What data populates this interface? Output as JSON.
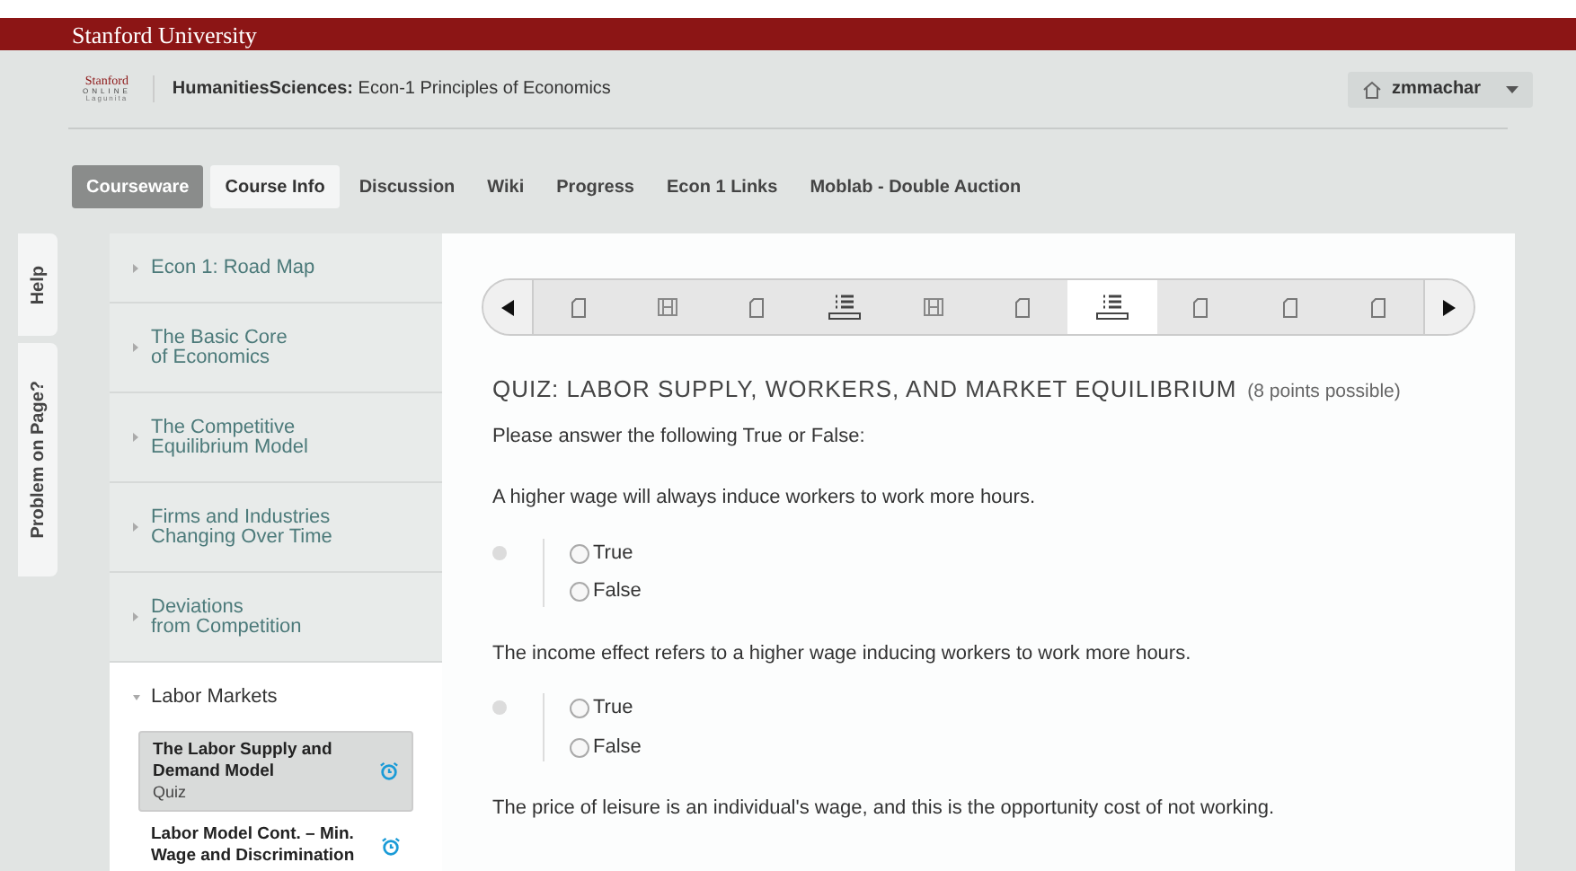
{
  "university_bar": {
    "title": "Stanford University"
  },
  "header": {
    "logo": {
      "line_1": "Stanford",
      "line_2": "ONLINE",
      "line_3": "Lagunita"
    },
    "course_org": "HumanitiesSciences:",
    "course_title": "Econ-1 Principles of Economics",
    "user": "zmmachar"
  },
  "nav_tabs": [
    {
      "label": "Courseware",
      "selected": true
    },
    {
      "label": "Course Info",
      "selected": false
    },
    {
      "label": "Discussion",
      "selected": false
    },
    {
      "label": "Wiki",
      "selected": false
    },
    {
      "label": "Progress",
      "selected": false
    },
    {
      "label": "Econ 1 Links",
      "selected": false
    },
    {
      "label": "Moblab - Double Auction",
      "selected": false
    }
  ],
  "side_tabs": [
    "Help",
    "Problem on Page?"
  ],
  "sidebar": {
    "chapters": [
      {
        "title": "Econ 1: Road Map",
        "expanded": false
      },
      {
        "title": "The Basic Core\nof Economics",
        "expanded": false
      },
      {
        "title": "The Competitive\nEquilibrium Model",
        "expanded": false
      },
      {
        "title": "Firms and Industries\nChanging Over Time",
        "expanded": false
      },
      {
        "title": "Deviations\nfrom Competition",
        "expanded": false
      },
      {
        "title": "Labor Markets",
        "expanded": true,
        "children": [
          {
            "title": "The Labor Supply and Demand Model",
            "subtitle": "Quiz",
            "selected": true,
            "due": true
          },
          {
            "title": "Labor Model Cont. – Min. Wage and Discrimination",
            "selected": false,
            "due": true
          }
        ]
      }
    ]
  },
  "sequence_nav": {
    "items": [
      {
        "kind": "text",
        "selected": false
      },
      {
        "kind": "video",
        "selected": false
      },
      {
        "kind": "text",
        "selected": false
      },
      {
        "kind": "problem",
        "selected": false
      },
      {
        "kind": "video",
        "selected": false
      },
      {
        "kind": "text",
        "selected": false
      },
      {
        "kind": "problem",
        "selected": true
      },
      {
        "kind": "text",
        "selected": false
      },
      {
        "kind": "text",
        "selected": false
      },
      {
        "kind": "text",
        "selected": false
      }
    ]
  },
  "quiz": {
    "title": "QUIZ: LABOR SUPPLY, WORKERS, AND MARKET EQUILIBRIUM",
    "points": "(8 points possible)",
    "instructions": "Please answer the following True or False:",
    "questions": [
      {
        "text": "A higher wage will always induce workers to work more hours.",
        "answered": false,
        "options": [
          {
            "label": "True",
            "checked": false
          },
          {
            "label": "False",
            "checked": false
          }
        ]
      },
      {
        "text": "The income effect refers to a higher wage inducing workers to work more hours.",
        "answered": false,
        "options": [
          {
            "label": "True",
            "checked": false
          },
          {
            "label": "False",
            "checked": false
          }
        ]
      },
      {
        "text": "The price of leisure is an individual's wage, and this is the opportunity cost of not working."
      }
    ]
  }
}
